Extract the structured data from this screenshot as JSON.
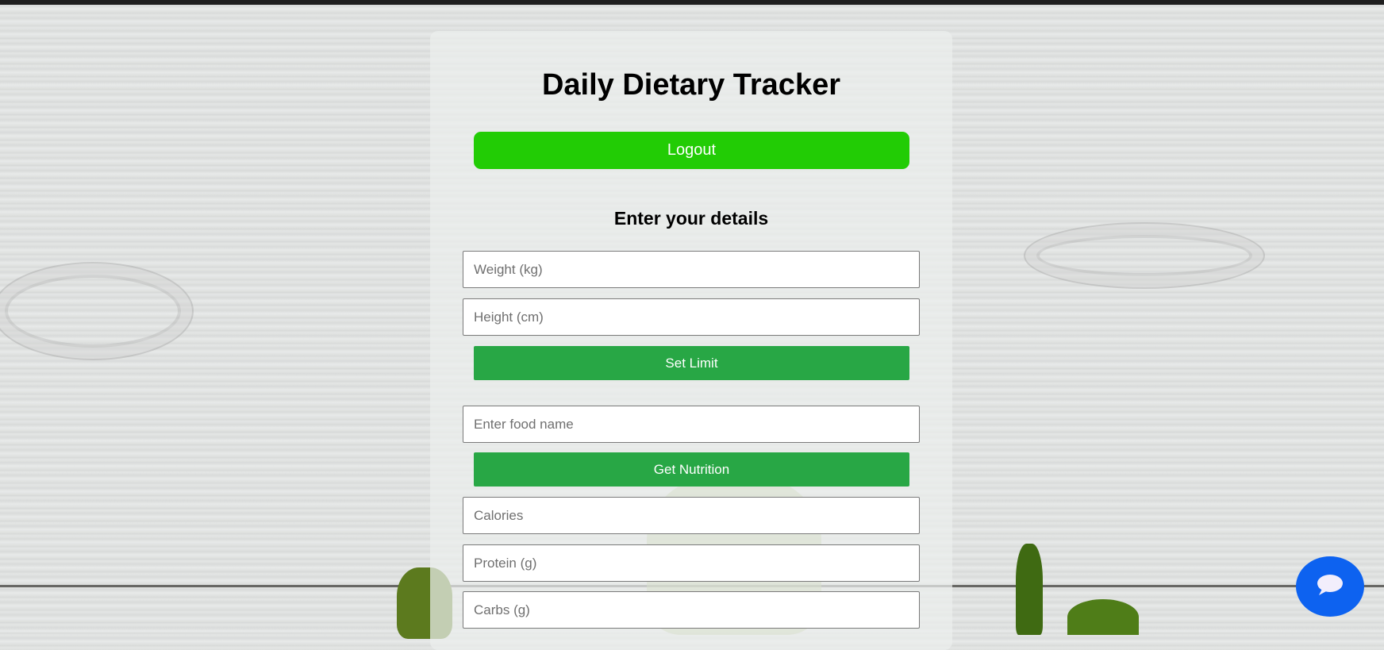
{
  "app": {
    "title": "Daily Dietary Tracker",
    "logout_label": "Logout"
  },
  "details": {
    "heading": "Enter your details",
    "weight_placeholder": "Weight (kg)",
    "height_placeholder": "Height (cm)",
    "set_limit_label": "Set Limit"
  },
  "food": {
    "name_placeholder": "Enter food name",
    "get_nutrition_label": "Get Nutrition",
    "calories_placeholder": "Calories",
    "protein_placeholder": "Protein (g)",
    "carbs_placeholder": "Carbs (g)"
  },
  "colors": {
    "logout_green": "#22cc05",
    "action_green": "#28a745",
    "chat_blue": "#0d62f0"
  },
  "icons": {
    "chat": "chat-bubble-icon"
  }
}
